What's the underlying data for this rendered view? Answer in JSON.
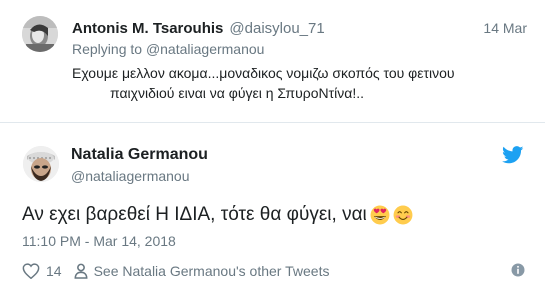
{
  "reply_tweet": {
    "name": "Antonis M. Tsarouhis",
    "handle": "@daisylou_71",
    "date": "14 Mar",
    "replying_prefix": "Replying to",
    "replying_handle": "@nataliagermanou",
    "text_line1": "Εχουμε μελλον ακομα...μοναδικος νομιζω σκοπός του φετινου",
    "text_line2": "παιχνιδιού ειναι να φύγει η ΣπυροΝτίνα!.."
  },
  "main_tweet": {
    "name": "Natalia Germanou",
    "handle": "@nataliagermanou",
    "text": "Αν εχει βαρεθεί Η ΙΔΙΑ, τότε θα φύγει, ναι",
    "emojis": [
      "heart-eyes-emoji",
      "smiling-face-emoji"
    ],
    "timestamp": "11:10 PM - Mar 14, 2018",
    "like_count": "14",
    "see_more_label": "See Natalia Germanou's other Tweets"
  },
  "colors": {
    "twitter_blue": "#1da1f2",
    "text_primary": "#1c2022",
    "text_secondary": "#697882",
    "divider": "#e1e8ed"
  },
  "icons": [
    "twitter-bird-icon",
    "heart-icon",
    "person-icon",
    "info-icon"
  ]
}
